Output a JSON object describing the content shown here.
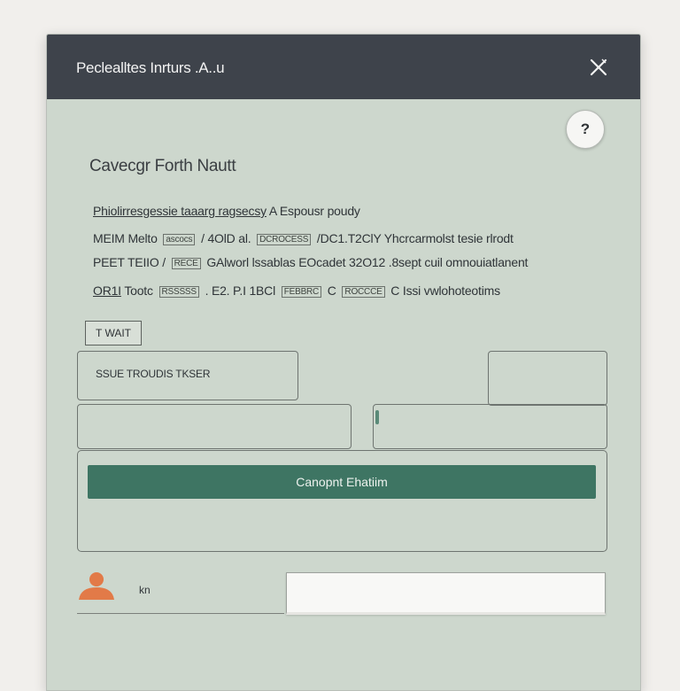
{
  "window": {
    "title": "Peclealltes Inrturs .A..u",
    "close_icon": "close-x-icon",
    "help_label": "?"
  },
  "form": {
    "heading": "Cavecgr Forth Nautt",
    "lines": [
      {
        "parts": [
          "Phiolirresgessie taaarg ragsecsy",
          "A",
          "Espousr poudy"
        ]
      },
      {
        "parts": [
          "MEIM",
          "Melto",
          "ascocs",
          "/ 4OlD al.",
          "DCROCESS",
          "/DC1.T2ClY",
          "Yhcrcarmolst tesie rlrodt"
        ]
      },
      {
        "parts": [
          "PEET",
          "TEIIO",
          "/",
          "RECE",
          "GAlworl lssablas",
          "EOcadet 32O12 .8sept cuil omnouiatlanent"
        ]
      },
      {
        "parts": [
          "OR1I",
          "Tootc",
          "RSSSSS",
          ". E2. P.I 1BCl",
          "FEBBRC",
          "C",
          "ROCCCE",
          "C",
          "Issi vwlohoteotims"
        ]
      }
    ],
    "small_button_label": "T WAIT",
    "field_left_text": "SSUE TROUDIS TKSER",
    "primary_button_label": "Canopnt Ehatiim",
    "footer_label": "kn",
    "footer_input_value": ""
  },
  "colors": {
    "titlebar": "#3e434b",
    "panel": "#cdd7cd",
    "primary": "#3e7563",
    "avatar": "#e27a48"
  }
}
